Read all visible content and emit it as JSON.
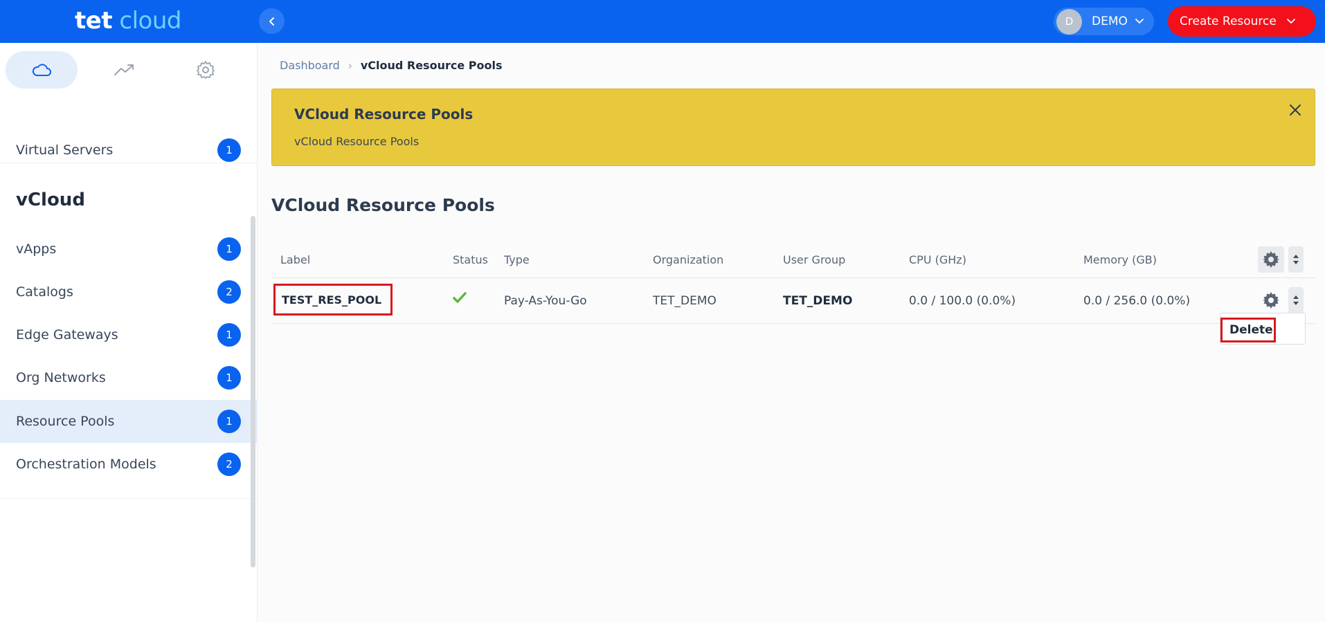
{
  "header": {
    "logo_part1": "tet",
    "logo_part2": "cloud",
    "user_initial": "D",
    "user_name": "DEMO",
    "create_label": "Create Resource",
    "brand_color": "#0a63ef",
    "create_color": "#f3101a"
  },
  "sidebar": {
    "tabs": [
      {
        "name": "cloud-icon",
        "active": true
      },
      {
        "name": "trending-up-icon",
        "active": false
      },
      {
        "name": "gear-icon",
        "active": false
      }
    ],
    "virtual_servers": {
      "label": "Virtual Servers",
      "count": "1"
    },
    "section_title": "vCloud",
    "items": [
      {
        "label": "vApps",
        "count": "1"
      },
      {
        "label": "Catalogs",
        "count": "2"
      },
      {
        "label": "Edge Gateways",
        "count": "1"
      },
      {
        "label": "Org Networks",
        "count": "1"
      },
      {
        "label": "Resource Pools",
        "count": "1",
        "active": true
      },
      {
        "label": "Orchestration Models",
        "count": "2"
      }
    ]
  },
  "breadcrumb": {
    "root": "Dashboard",
    "current": "vCloud Resource Pools"
  },
  "banner": {
    "title": "VCloud Resource Pools",
    "text": "vCloud Resource Pools",
    "color": "#e8c93e"
  },
  "page_title": "VCloud Resource Pools",
  "table": {
    "columns": [
      "Label",
      "Status",
      "Type",
      "Organization",
      "User Group",
      "CPU (GHz)",
      "Memory (GB)"
    ],
    "rows": [
      {
        "label": "TEST_RES_POOL",
        "status": "check-icon",
        "type": "Pay-As-You-Go",
        "organization": "TET_DEMO",
        "user_group": "TET_DEMO",
        "cpu": "0.0 / 100.0 (0.0%)",
        "memory": "0.0 / 256.0 (0.0%)"
      }
    ]
  },
  "row_menu": {
    "delete_label": "Delete"
  }
}
